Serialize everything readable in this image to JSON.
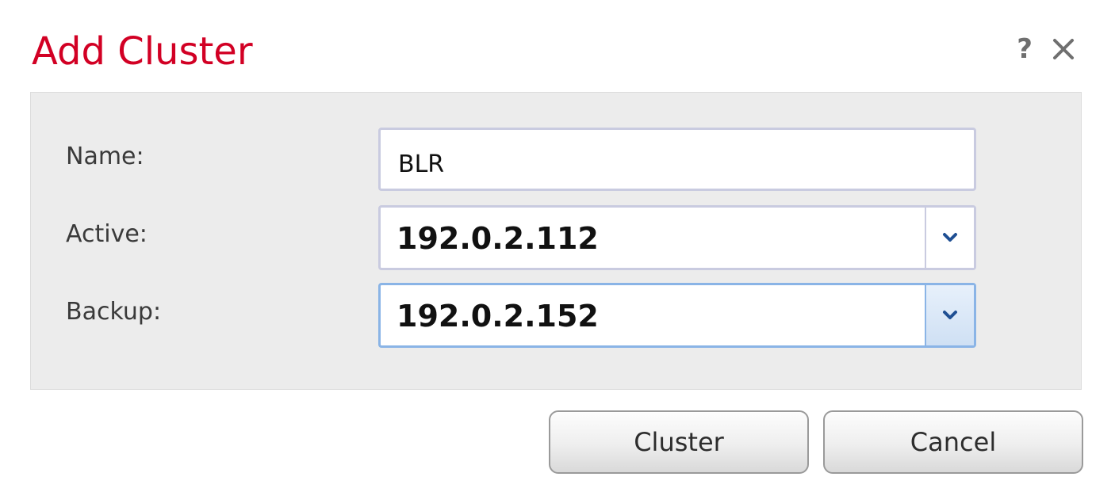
{
  "dialog": {
    "title": "Add Cluster",
    "help_glyph": "?",
    "icons": {
      "help": "help-icon",
      "close": "close-icon",
      "dropdown": "chevron-down-icon"
    }
  },
  "form": {
    "name": {
      "label": "Name:",
      "value": "BLR"
    },
    "active": {
      "label": "Active:",
      "value": "192.0.2.112"
    },
    "backup": {
      "label": "Backup:",
      "value": "192.0.2.152",
      "focused": true
    }
  },
  "buttons": {
    "primary_label": "Cluster",
    "cancel_label": "Cancel"
  },
  "colors": {
    "title": "#d20024",
    "panel_background": "#ececec",
    "focus_border": "#8ab4e6",
    "chevron": "#1f4f93"
  }
}
